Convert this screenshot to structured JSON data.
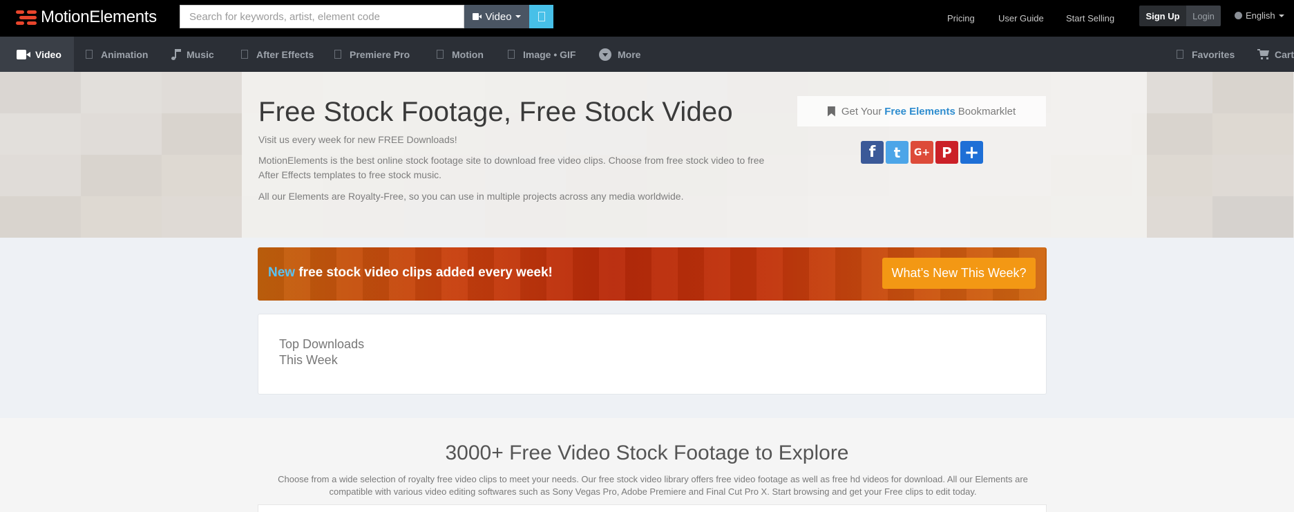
{
  "brand": {
    "name": "MotionElements",
    "accent": "#e8452c"
  },
  "search": {
    "placeholder": "Search for keywords, artist, element code",
    "value": "",
    "type_label": "Video"
  },
  "top_links": {
    "pricing": "Pricing",
    "user_guide": "User Guide",
    "start_selling": "Start Selling",
    "sign_up": "Sign Up",
    "login": "Login",
    "language": "English"
  },
  "nav": {
    "items": [
      {
        "label": "Video",
        "icon": "video-camera-icon",
        "active": true
      },
      {
        "label": "Animation",
        "icon": "animation-icon"
      },
      {
        "label": "Music",
        "icon": "music-note-icon"
      },
      {
        "label": "After Effects",
        "icon": "after-effects-icon"
      },
      {
        "label": "Premiere Pro",
        "icon": "premiere-pro-icon"
      },
      {
        "label": "Motion",
        "icon": "motion-icon"
      },
      {
        "label": "Image • GIF",
        "icon": "image-icon"
      },
      {
        "label": "More",
        "icon": "chevron-circle-down-icon"
      }
    ],
    "favorites": "Favorites",
    "cart": "Cart"
  },
  "hero": {
    "title": "Free Stock Footage, Free Stock Video",
    "line1": "Visit us every week for new FREE Downloads!",
    "line2": "MotionElements is the best online stock footage site to download free video clips. Choose from free stock video to free After Effects templates to free stock music.",
    "line3": "All our Elements are Royalty-Free, so you can use in multiple projects across any media worldwide.",
    "bookmarklet": {
      "prefix": "Get Your",
      "highlight": "Free Elements",
      "suffix": "Bookmarklet"
    },
    "social": [
      {
        "name": "facebook-share-icon",
        "glyph": "f",
        "color": "#3b5998"
      },
      {
        "name": "twitter-share-icon",
        "glyph": "t",
        "color": "#4ca5e8"
      },
      {
        "name": "google-plus-share-icon",
        "glyph": "G+",
        "color": "#dd4b39"
      },
      {
        "name": "pinterest-share-icon",
        "glyph": "P",
        "color": "#cb2027"
      },
      {
        "name": "add-share-icon",
        "glyph": "+",
        "color": "#1e6fd6"
      }
    ]
  },
  "promo": {
    "new_word": "New",
    "text": "free stock video clips added every week!",
    "button": "What’s New This Week?"
  },
  "top_downloads": {
    "line1": "Top Downloads",
    "line2": "This Week"
  },
  "explore": {
    "title": "3000+ Free Video Stock Footage to Explore",
    "description": "Choose from a wide selection of royalty free video clips to meet your needs. Our free stock video library offers free video footage as well as free hd videos for download. All our Elements are compatible with various video editing softwares such as Sony Vegas Pro, Adobe Premiere and Final Cut Pro X. Start browsing and get your Free clips to edit today."
  }
}
